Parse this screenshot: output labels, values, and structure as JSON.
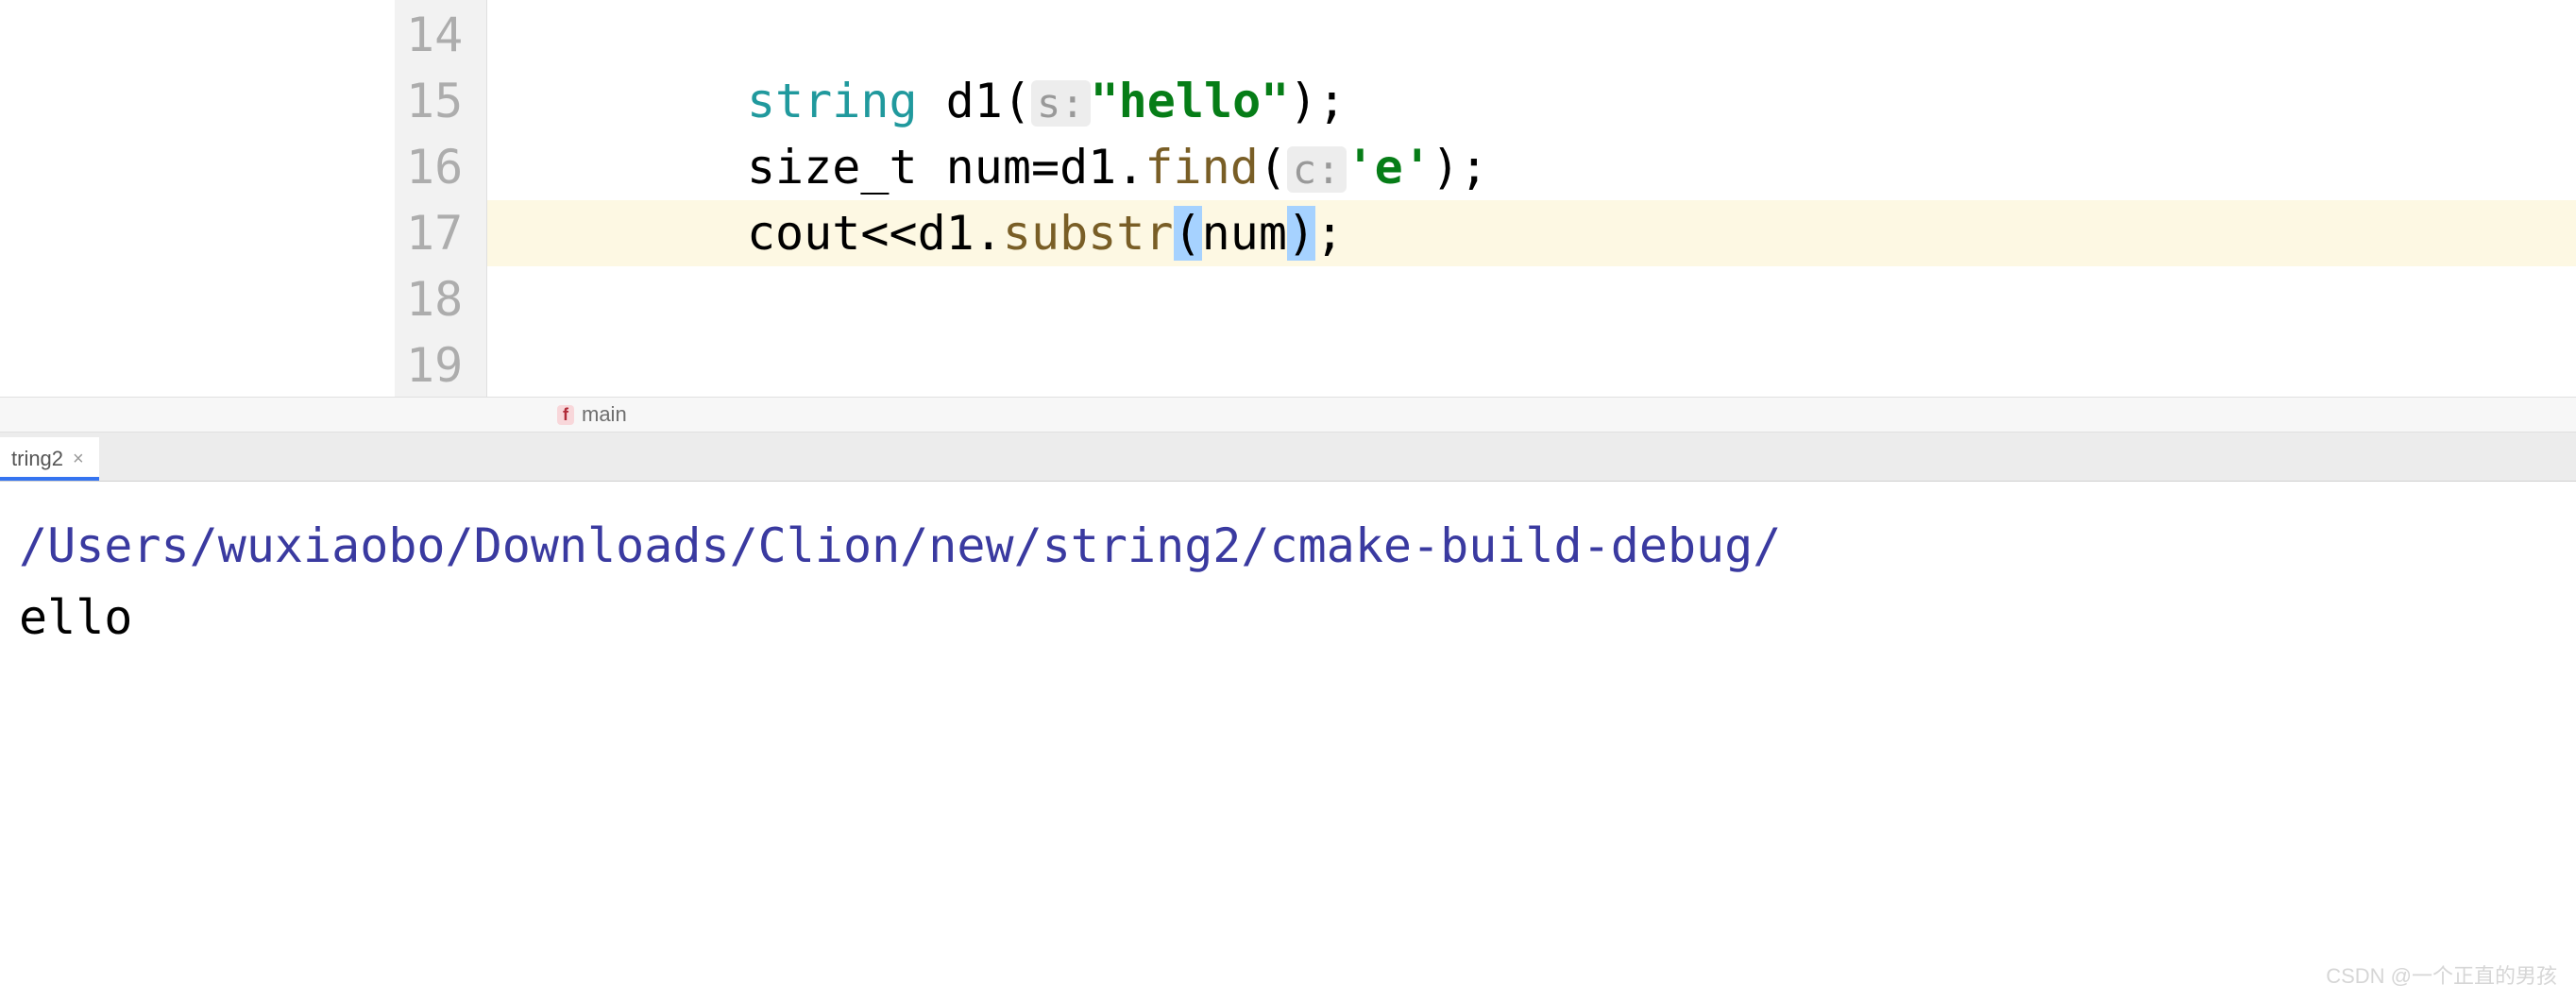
{
  "gutter": {
    "lines": [
      "14",
      "15",
      "16",
      "17",
      "18",
      "19"
    ]
  },
  "code": {
    "line15": {
      "indent": "         ",
      "keyword_string": "string",
      "var": " d1(",
      "hint": "s:",
      "literal": "\"hello\"",
      "end": ");"
    },
    "line16": {
      "indent": "         ",
      "type": "size_t",
      "mid": " num=d1.",
      "func": "find",
      "open": "(",
      "hint": "c:",
      "literal": "'e'",
      "end": ");"
    },
    "line17": {
      "indent": "         ",
      "cout": "cout",
      "op": "<<",
      "obj": "d1.",
      "func": "substr",
      "open": "(",
      "arg": "num",
      "close": ")",
      "semi": ";"
    }
  },
  "breadcrumb": {
    "icon": "f",
    "label": "main"
  },
  "tab": {
    "label": "tring2",
    "close": "×"
  },
  "console": {
    "path": "/Users/wuxiaobo/Downloads/Clion/new/string2/cmake-build-debug/",
    "output": "ello"
  },
  "watermark": "CSDN @一个正直的男孩"
}
